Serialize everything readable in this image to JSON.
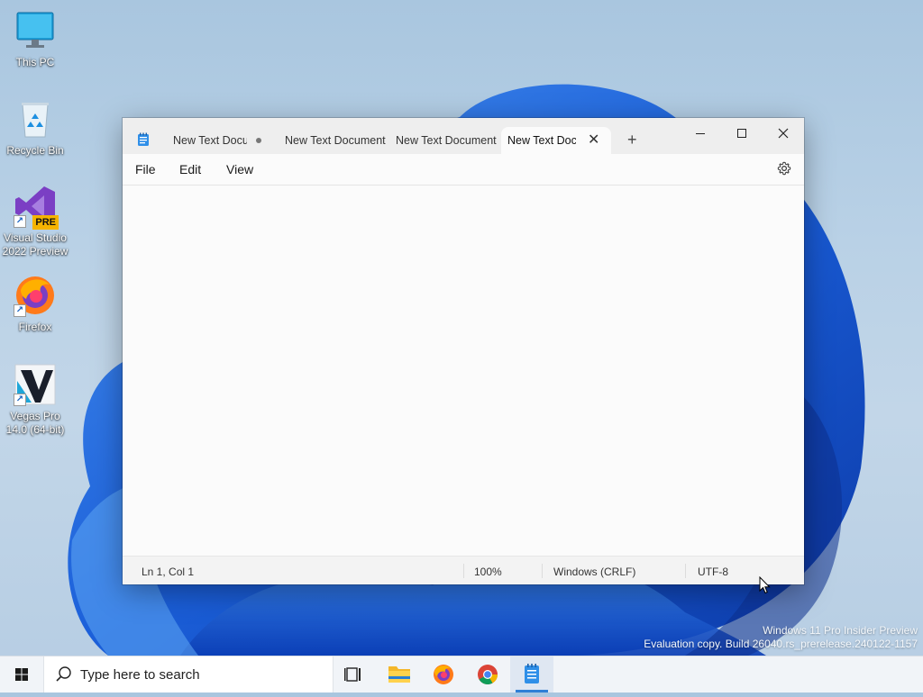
{
  "desktop": {
    "icons": [
      {
        "label": "This PC"
      },
      {
        "label": "Recycle Bin"
      },
      {
        "label": "Visual Studio 2022 Preview",
        "badge": "PRE"
      },
      {
        "label": "Firefox"
      },
      {
        "label": "Vegas Pro 14.0 (64-bit)"
      }
    ],
    "watermark": {
      "line1": "Windows 11 Pro Insider Preview",
      "line2": "Evaluation copy. Build 26040.rs_prerelease.240122-1157"
    }
  },
  "notepad": {
    "tabs": [
      {
        "label": "New Text Docu",
        "unsaved": true,
        "active": false
      },
      {
        "label": "New Text Document",
        "active": false
      },
      {
        "label": "New Text Document",
        "active": false
      },
      {
        "label": "New Text Doc",
        "active": true
      }
    ],
    "new_tab_glyph": "+",
    "menu": {
      "file": "File",
      "edit": "Edit",
      "view": "View"
    },
    "editor_text": "",
    "status": {
      "position": "Ln 1, Col 1",
      "zoom": "100%",
      "line_ending": "Windows (CRLF)",
      "encoding": "UTF-8"
    }
  },
  "taskbar": {
    "search_placeholder": "Type here to search",
    "items": [
      "task-view",
      "file-explorer",
      "firefox",
      "chrome",
      "notepad"
    ],
    "active_item": "notepad"
  },
  "colors": {
    "accent": "#2f7fd6",
    "wallpaper_bloom": "#1a5fd8"
  }
}
